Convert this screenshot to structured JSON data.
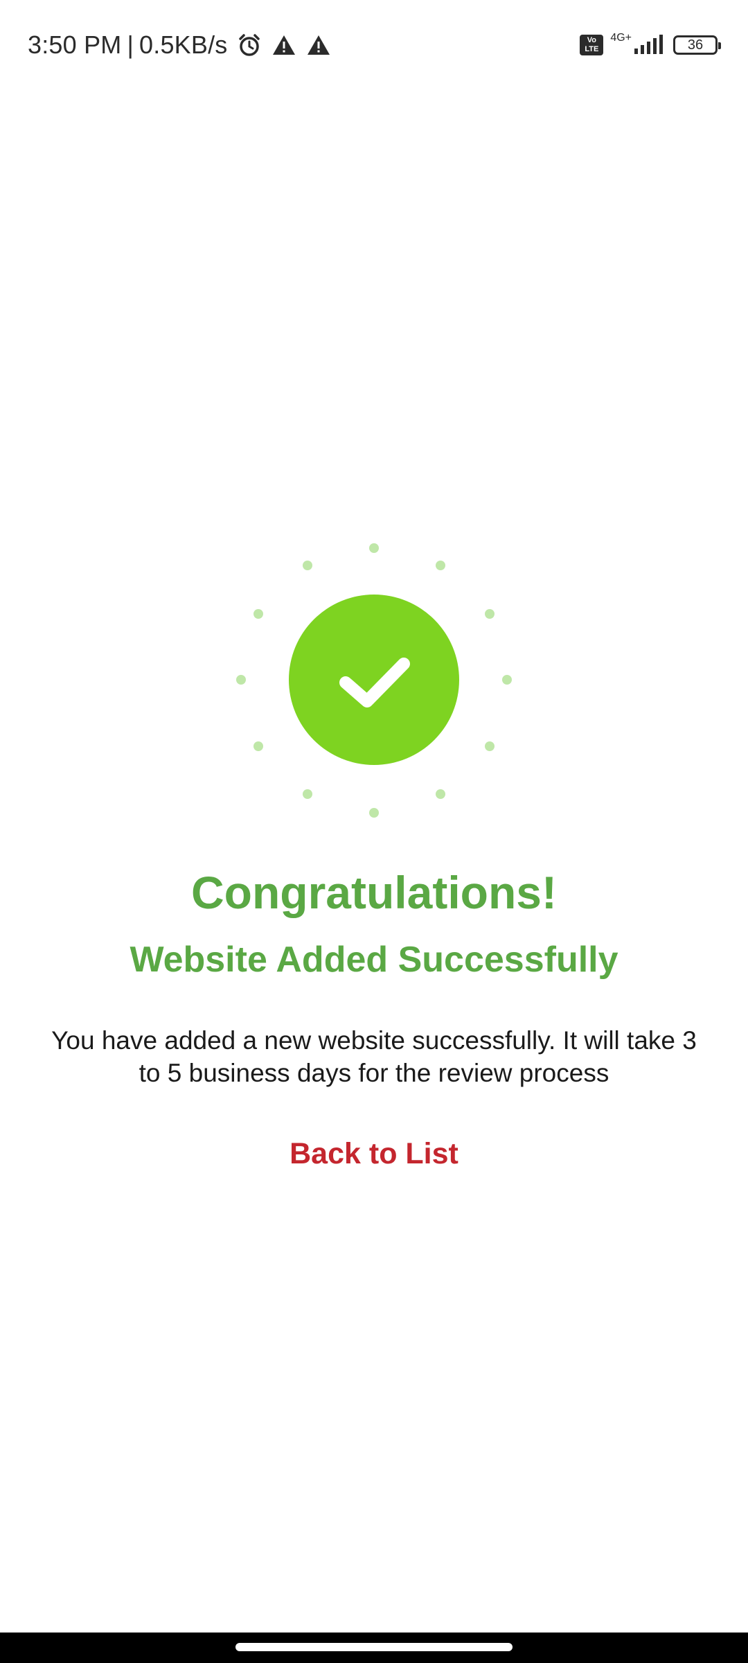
{
  "status_bar": {
    "time": "3:50 PM",
    "separator": "|",
    "speed": "0.5KB/s",
    "icons": [
      "alarm-icon",
      "warning-icon",
      "warning-icon",
      "volte-icon",
      "signal-icon",
      "battery-icon"
    ],
    "volte_top": "Vo",
    "volte_bottom": "LTE",
    "network_type": "4G+",
    "battery_level": "36"
  },
  "success": {
    "icon": "checkmark-icon",
    "circle_color": "#7ed321",
    "dot_color": "#bfe7a8"
  },
  "content": {
    "headline": "Congratulations!",
    "subhead": "Website Added Successfully",
    "message": "You have added a new website successfully. It will take 3 to 5 business days for the review process",
    "back_link": "Back to List"
  },
  "colors": {
    "accent_green": "#5aa844",
    "link_red": "#c4262e"
  }
}
